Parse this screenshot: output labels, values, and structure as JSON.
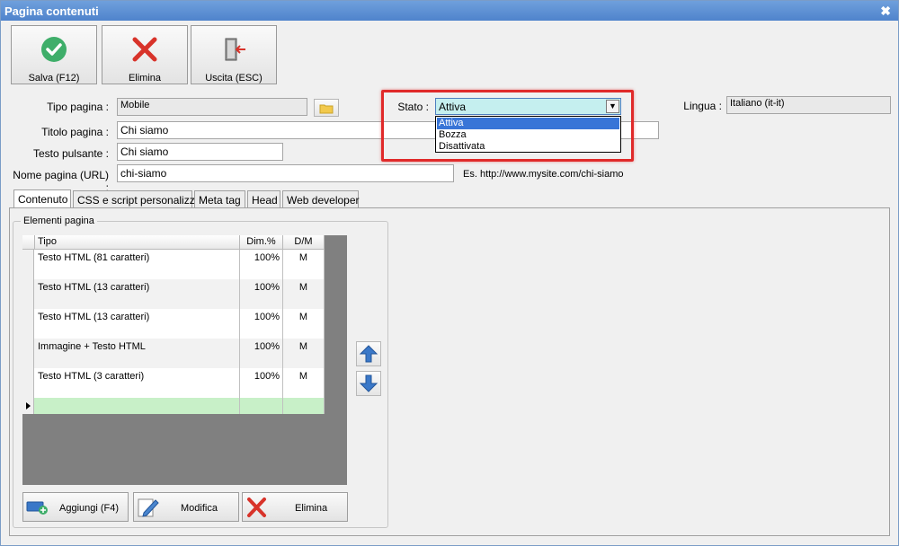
{
  "window": {
    "title": "Pagina contenuti",
    "close_glyph": "✖"
  },
  "toolbar": {
    "save_label": "Salva (F12)",
    "delete_label": "Elimina",
    "exit_label": "Uscita (ESC)"
  },
  "form": {
    "tipo_pagina_label": "Tipo pagina :",
    "tipo_pagina_value": "Mobile",
    "stato_label": "Stato :",
    "stato_value": "Attiva",
    "stato_options": [
      "Attiva",
      "Bozza",
      "Disattivata"
    ],
    "lingua_label": "Lingua :",
    "lingua_value": "Italiano (it-it)",
    "titolo_label": "Titolo pagina :",
    "titolo_value": "Chi siamo",
    "testo_pulsante_label": "Testo pulsante :",
    "testo_pulsante_value": "Chi siamo",
    "nome_pagina_label": "Nome pagina (URL) :",
    "nome_pagina_value": "chi-siamo",
    "url_example": "Es. http://www.mysite.com/chi-siamo"
  },
  "tabs": [
    "Contenuto",
    "CSS e script personalizzati",
    "Meta tag",
    "Head",
    "Web developer"
  ],
  "elements": {
    "group_title": "Elementi pagina",
    "columns": [
      "Tipo",
      "Dim.%",
      "D/M"
    ],
    "rows": [
      {
        "tipo": "Testo HTML (81 caratteri)",
        "dim": "100%",
        "dm": "M"
      },
      {
        "tipo": "Testo HTML (13 caratteri)",
        "dim": "100%",
        "dm": "M"
      },
      {
        "tipo": "Testo HTML (13 caratteri)",
        "dim": "100%",
        "dm": "M"
      },
      {
        "tipo": "Immagine + Testo HTML",
        "dim": "100%",
        "dm": "M"
      },
      {
        "tipo": "Testo HTML (3 caratteri)",
        "dim": "100%",
        "dm": "M"
      }
    ],
    "add_label": "Aggiungi (F4)",
    "edit_label": "Modifica",
    "delete_label": "Elimina"
  },
  "colors": {
    "accent": "#3875d7",
    "highlight_box": "#e02a2a",
    "save_green": "#3fae6a",
    "delete_red": "#d8332a",
    "new_row": "#c8f0c8"
  }
}
